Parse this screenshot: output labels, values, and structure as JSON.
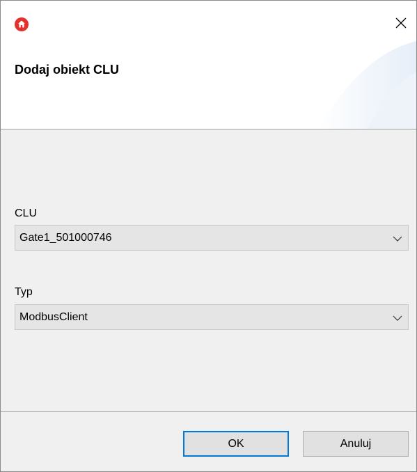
{
  "window": {
    "close_symbol": "✕",
    "app_icon": "home-icon",
    "accent_color": "#e4312b"
  },
  "header": {
    "title": "Dodaj obiekt CLU"
  },
  "form": {
    "clu": {
      "label": "CLU",
      "value": "Gate1_501000746"
    },
    "typ": {
      "label": "Typ",
      "value": "ModbusClient"
    }
  },
  "buttons": {
    "ok": "OK",
    "cancel": "Anuluj"
  }
}
